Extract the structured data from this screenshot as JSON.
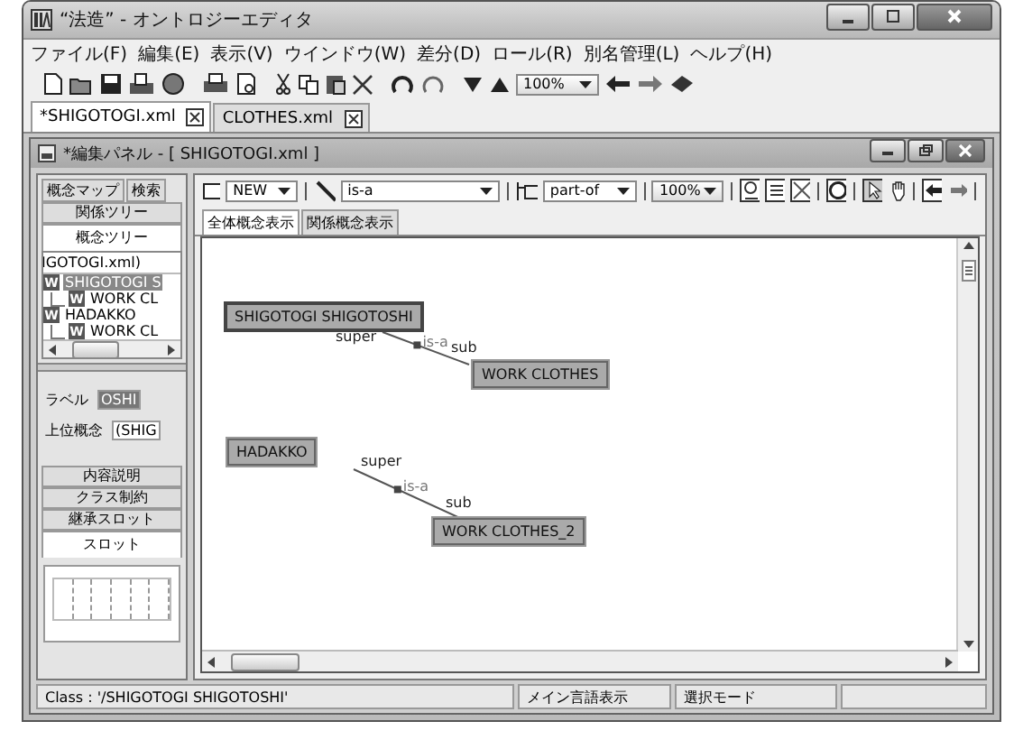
{
  "window": {
    "title": "“法造” - オントロジーエディタ"
  },
  "menu": [
    "ファイル(F)",
    "編集(E)",
    "表示(V)",
    "ウインドウ(W)",
    "差分(D)",
    "ロール(R)",
    "別名管理(L)",
    "ヘルプ(H)"
  ],
  "toolbar": {
    "zoom": "100%"
  },
  "file_tabs": [
    {
      "label": "*SHIGOTOGI.xml",
      "selected": true
    },
    {
      "label": "CLOTHES.xml",
      "selected": false
    }
  ],
  "inner_window": {
    "title": "*編集パネル - [ SHIGOTOGI.xml ]"
  },
  "left_panel": {
    "top_tabs": [
      {
        "label": "概念マップ",
        "selected": false
      },
      {
        "label": "検索",
        "selected": false
      }
    ],
    "tree_tabs": [
      {
        "label": "関係ツリー",
        "selected": false
      },
      {
        "label": "概念ツリー",
        "selected": true
      }
    ],
    "tree": {
      "root": "IGOTOGI.xml)",
      "items": [
        {
          "badge": "W",
          "label": "SHIGOTOGI S",
          "selected": true,
          "children": [
            {
              "badge": "W",
              "label": "WORK CL",
              "selected": false
            }
          ]
        },
        {
          "badge": "W",
          "label": "HADAKKO",
          "selected": false,
          "children": [
            {
              "badge": "W",
              "label": "WORK CL",
              "selected": false
            }
          ]
        }
      ]
    },
    "fields": [
      {
        "label": "ラベル",
        "value": "OSHI",
        "highlighted": true
      },
      {
        "label": "上位概念",
        "value": "(SHIG",
        "highlighted": false
      }
    ],
    "detail_tabs": [
      {
        "label": "内容説明",
        "selected": false
      },
      {
        "label": "クラス制約",
        "selected": false
      },
      {
        "label": "継承スロット",
        "selected": false
      },
      {
        "label": "スロット",
        "selected": true
      }
    ]
  },
  "editor": {
    "node_select": "NEW",
    "link_select": "is-a",
    "part_select": "part-of",
    "zoom": "100%",
    "view_tabs": [
      {
        "label": "全体概念表示",
        "selected": true
      },
      {
        "label": "関係概念表示",
        "selected": false
      }
    ],
    "nodes": [
      {
        "label": "SHIGOTOGI SHIGOTOSHI",
        "selected": true
      },
      {
        "label": "WORK CLOTHES",
        "selected": false
      },
      {
        "label": "HADAKKO",
        "selected": false
      },
      {
        "label": "WORK CLOTHES_2",
        "selected": false
      }
    ],
    "links": [
      {
        "type": "is-a",
        "super_label": "super",
        "sub_label": "sub"
      },
      {
        "type": "is-a",
        "super_label": "super",
        "sub_label": "sub"
      }
    ]
  },
  "status_bar": {
    "class": "Class : '/SHIGOTOGI SHIGOTOSHI'",
    "language": "メイン言語表示",
    "mode": "選択モード"
  }
}
